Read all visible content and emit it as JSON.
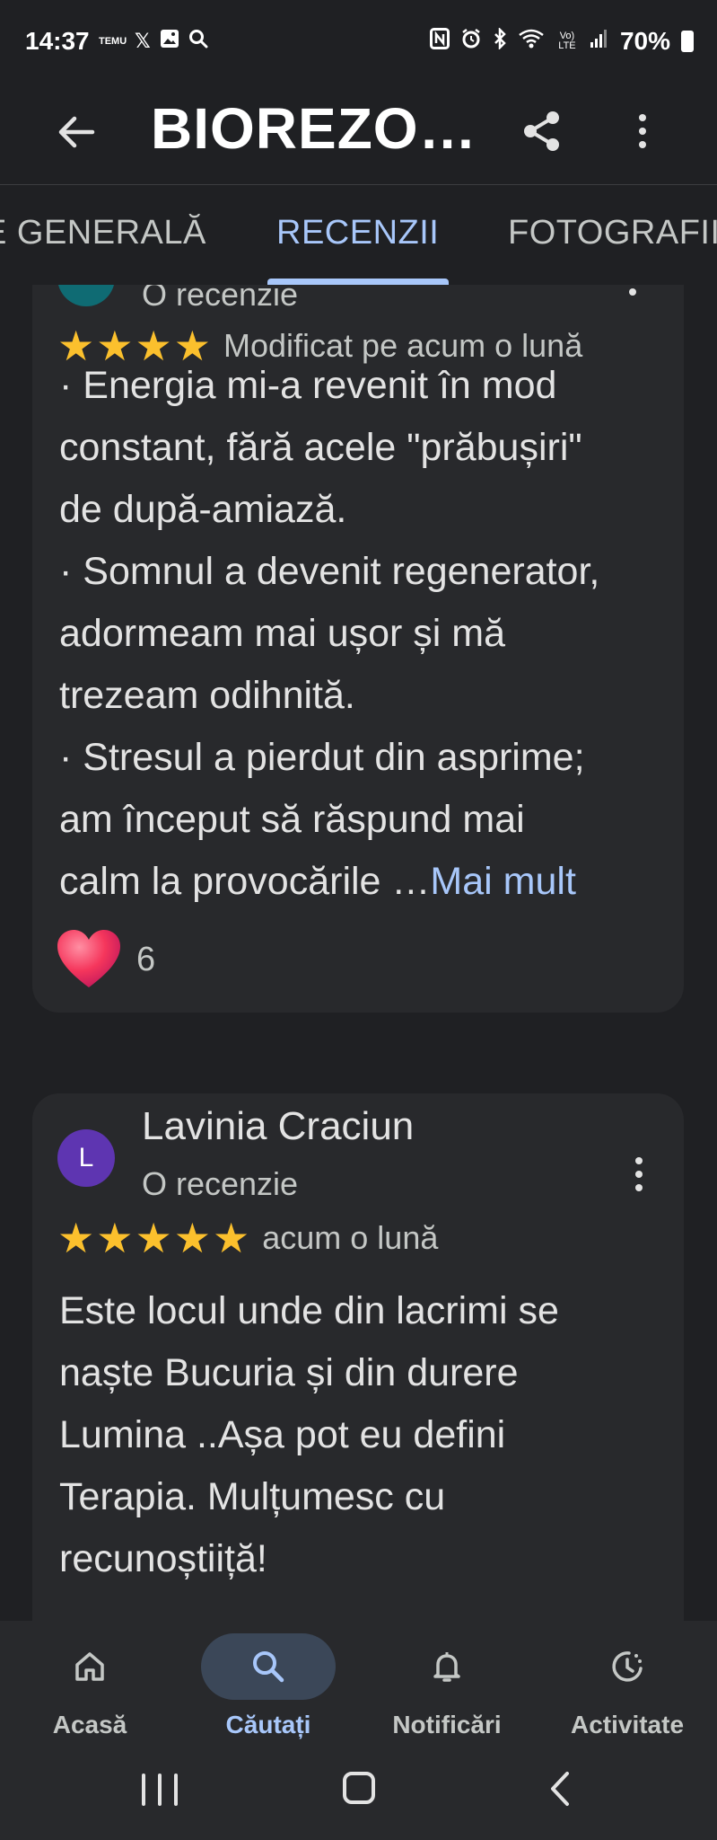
{
  "status_bar": {
    "time": "14:37",
    "left_icons": [
      "temu-icon",
      "x-icon",
      "gallery-icon",
      "search-icon"
    ],
    "temu_label": "TEMU",
    "right_icons": [
      "nfc-icon",
      "alarm-icon",
      "bluetooth-icon",
      "wifi-icon",
      "volte-icon",
      "signal-icon"
    ],
    "volte_label": "Vo) LTE",
    "battery": "70%"
  },
  "app_bar": {
    "title": "BIOREZO…"
  },
  "tabs": [
    {
      "label": "E GENERALĂ",
      "active": false
    },
    {
      "label": "RECENZII",
      "active": true
    },
    {
      "label": "FOTOGRAFII",
      "active": false
    }
  ],
  "reviews": [
    {
      "review_count": "O recenzie",
      "stars": 4,
      "date": "Modificat pe acum o lună",
      "text_lines": [
        "· Energia mi-a revenit în mod",
        "constant, fără acele \"prăbușiri\"",
        "de după-amiază.",
        "· Somnul a devenit regenerator,",
        "adormeam mai ușor și mă",
        "trezeam odihnită.",
        "· Stresul a pierdut din asprime;",
        "am început să răspund mai",
        "calm la provocările …"
      ],
      "more_label": "Mai mult",
      "reaction_count": "6"
    },
    {
      "author": "Lavinia Craciun",
      "avatar_letter": "L",
      "review_count": "O recenzie",
      "stars": 5,
      "date": "acum o lună",
      "text_lines": [
        "Este locul unde din lacrimi se",
        "naște Bucuria și din durere",
        "Lumina ..Așa pot eu defini",
        "Terapia. Mulțumesc cu",
        "recunoștiiță!"
      ]
    }
  ],
  "bottom_nav": [
    {
      "label": "Acasă",
      "icon": "home-icon",
      "active": false
    },
    {
      "label": "Căutați",
      "icon": "search-icon",
      "active": true
    },
    {
      "label": "Notificări",
      "icon": "bell-icon",
      "active": false
    },
    {
      "label": "Activitate",
      "icon": "activity-icon",
      "active": false
    }
  ],
  "colors": {
    "background": "#1f2023",
    "card": "#28292c",
    "accent": "#a8c7fa",
    "star": "#fbc02d",
    "avatar_l": "#5e35b1"
  }
}
